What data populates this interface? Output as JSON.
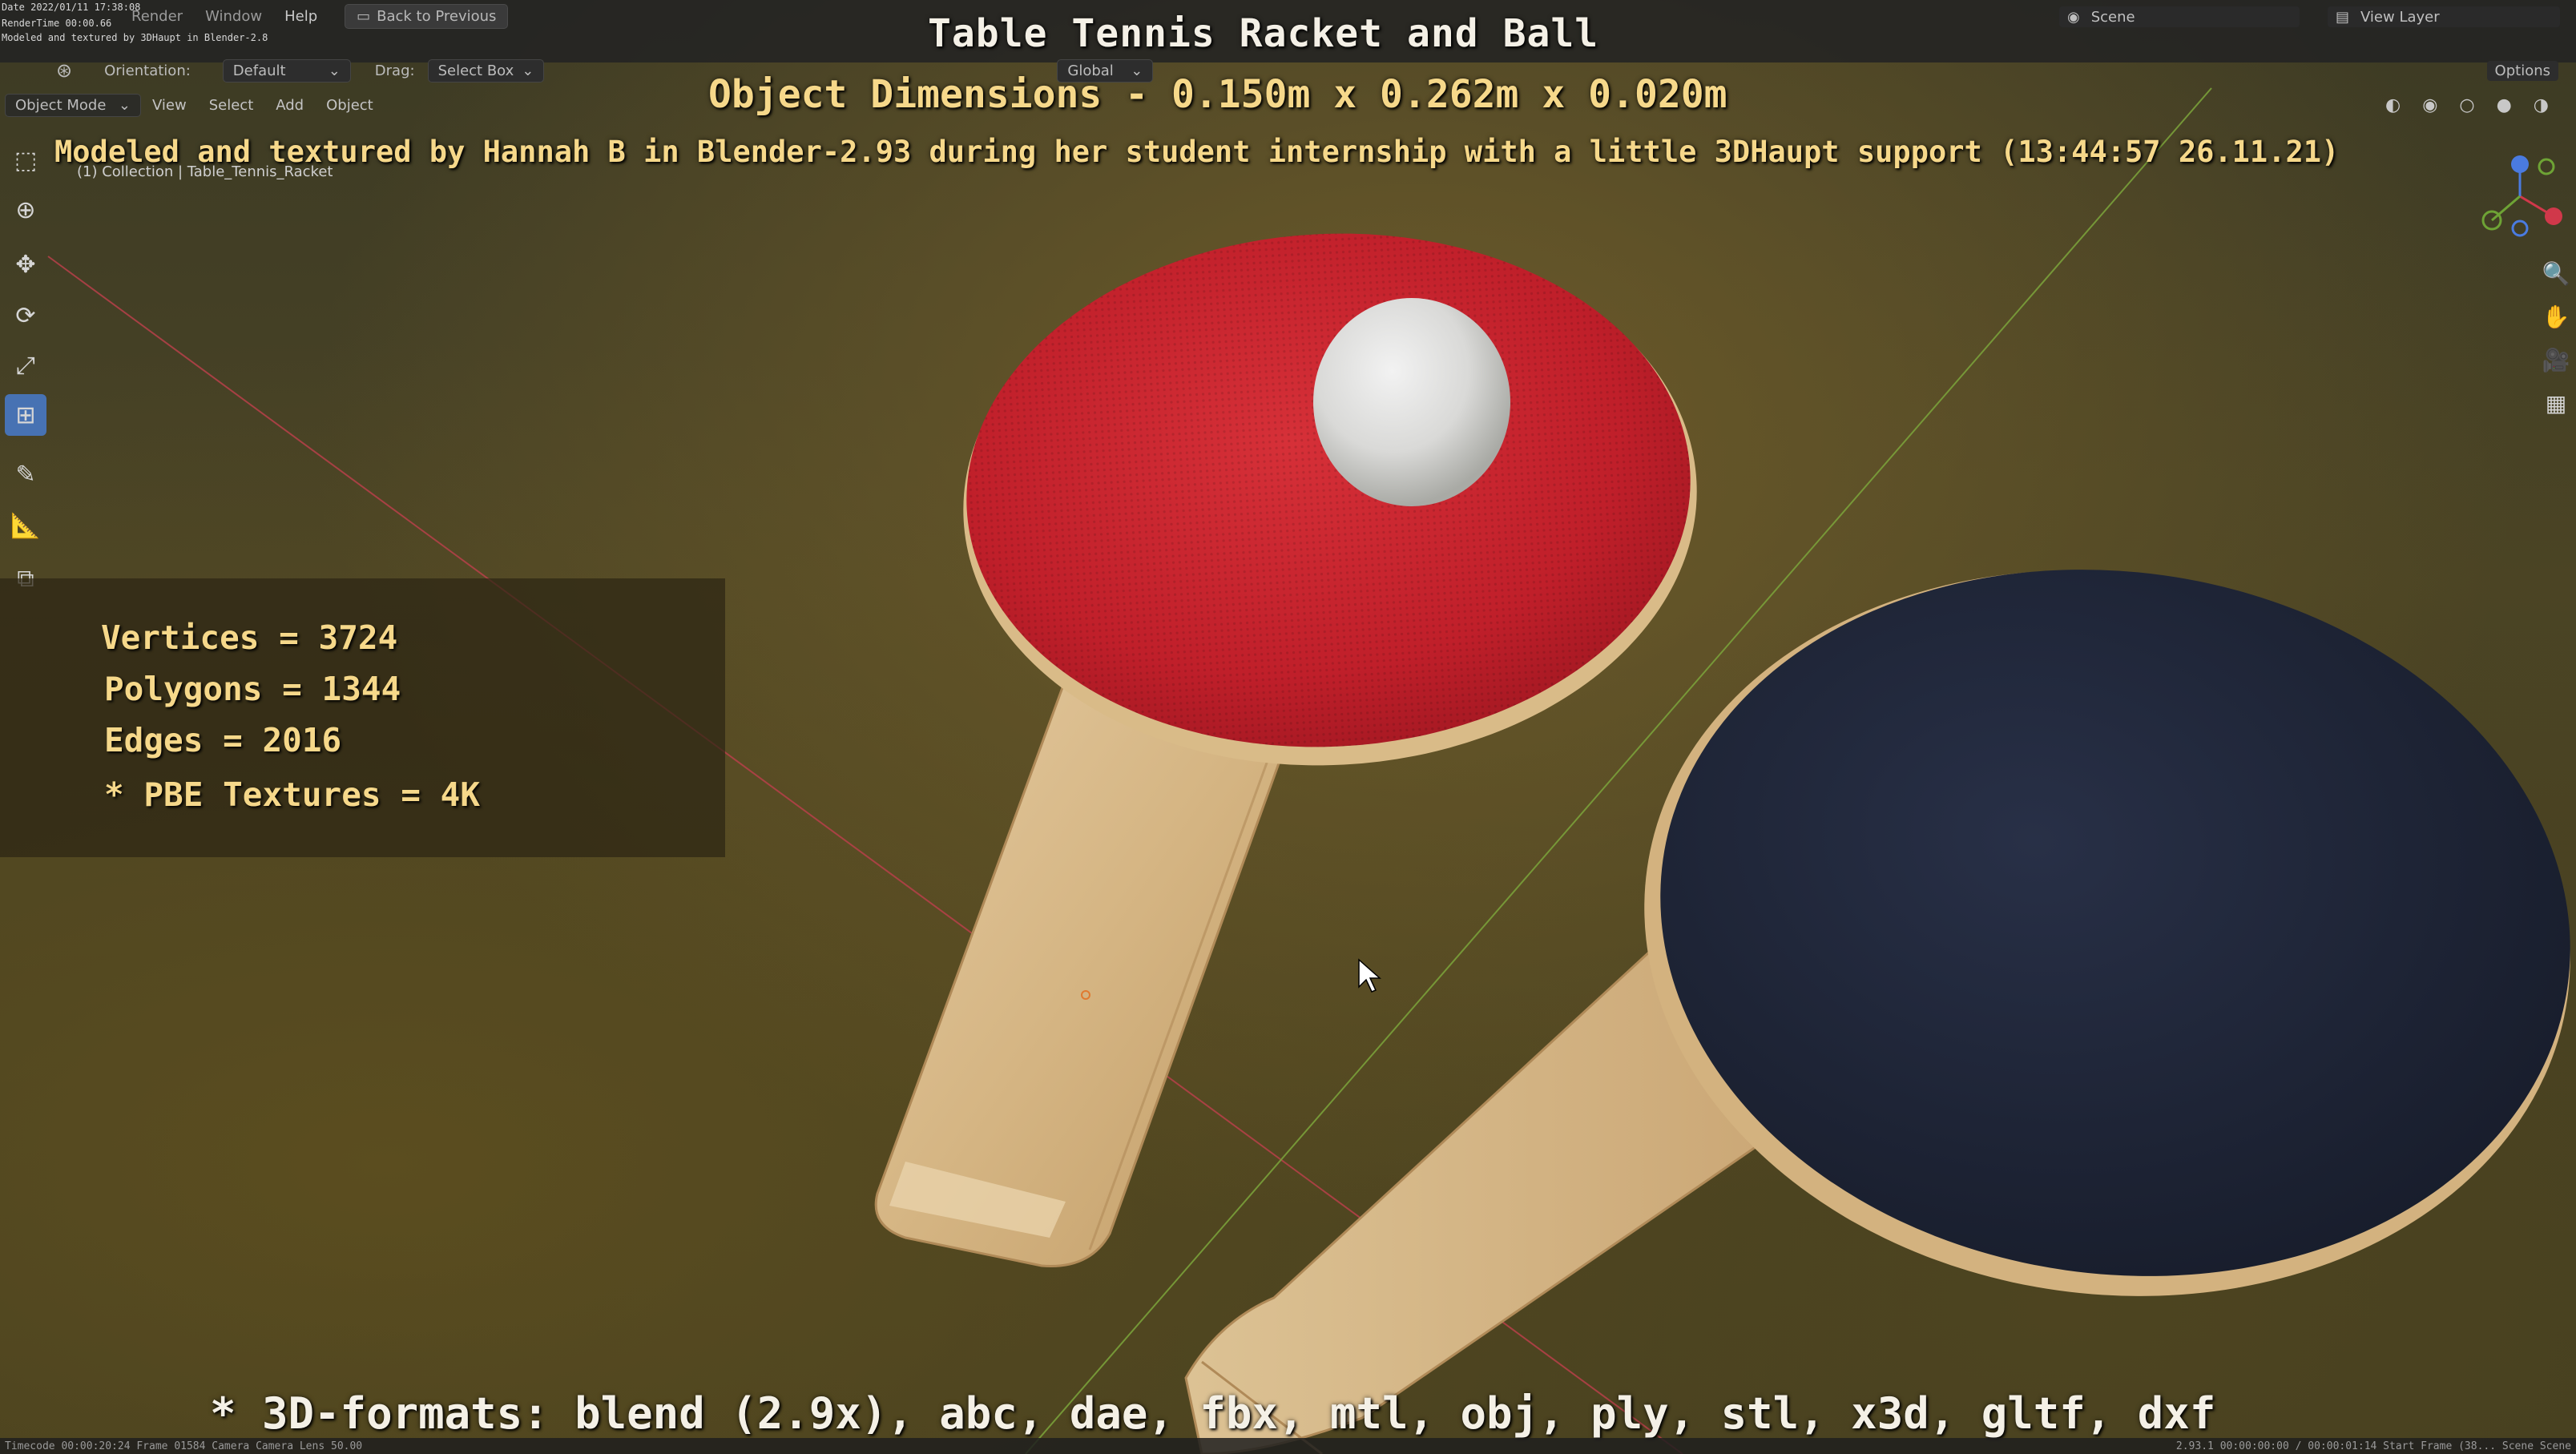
{
  "overlay": {
    "title": "Table Tennis Racket and Ball",
    "dimensions": "Object Dimensions -  0.150m x 0.262m x 0.020m",
    "credit": "Modeled and textured by Hannah B in Blender-2.93 during her student internship with a little 3DHaupt support (13:44:57 26.11.21)",
    "formats": "* 3D-formats: blend (2.9x), abc, dae, fbx, mtl, obj, ply, stl, x3d, gltf, dxf"
  },
  "stats": {
    "vertices": "Vertices = 3724",
    "polygons": "Polygons = 1344",
    "edges": "Edges = 2016",
    "textures": "* PBE Textures = 4K"
  },
  "render_info": {
    "date": "Date 2022/01/11 17:38:08",
    "render_time": "RenderTime 00:00.66",
    "note": "Modeled and textured by 3DHaupt in Blender-2.8"
  },
  "header": {
    "menu": [
      "Render",
      "Window",
      "Help"
    ],
    "back_button": "Back to Previous",
    "scene": "Scene",
    "view_layer": "View Layer",
    "orientation_label": "Orientation:",
    "orientation_value": "Default",
    "drag_label": "Drag:",
    "drag_value": "Select Box",
    "transform_value": "Global",
    "options": "Options"
  },
  "viewport_header": {
    "mode": "Object Mode",
    "menus": [
      "View",
      "Select",
      "Add",
      "Object"
    ],
    "collection": "(1) Collection | Table_Tennis_Racket"
  },
  "statusbar": {
    "left": "Timecode 00:00:20:24   Frame 01584   Camera Camera   Lens 50.00",
    "right": "2.93.1  00:00:00:00 / 00:00:01:14       Start Frame (38...  Scene Scene"
  },
  "icons": {
    "tools": [
      "select-box-icon",
      "cursor-icon",
      "move-icon",
      "rotate-icon",
      "scale-icon",
      "transform-icon",
      "annotate-icon",
      "measure-icon",
      "add-cube-icon"
    ],
    "nav": [
      "zoom-icon",
      "hand-pan-icon",
      "camera-icon",
      "grid-icon"
    ]
  },
  "colors": {
    "overlay_yellow": "#f6d88a",
    "overlay_white": "#f4f0e6",
    "active_tool": "#4772b3",
    "rubber_red": "#c5222c",
    "rubber_black": "#1f2535",
    "wood": "#d6b884"
  }
}
